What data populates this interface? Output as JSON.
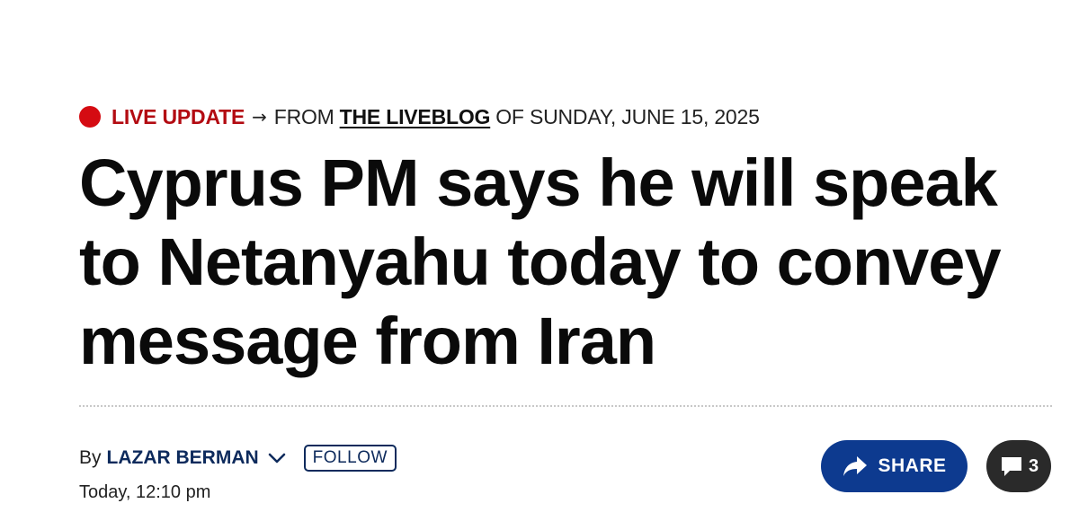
{
  "kicker": {
    "live_label": "LIVE UPDATE",
    "arrow": "→",
    "from_text": "FROM",
    "liveblog_link": "THE LIVEBLOG",
    "of_text": "OF SUNDAY, JUNE 15, 2025"
  },
  "headline": "Cyprus PM says he will speak to Netanyahu today to convey message from Iran",
  "byline": {
    "by_text": "By",
    "author": "LAZAR BERMAN",
    "follow_label": "FOLLOW",
    "timestamp": "Today, 12:10 pm"
  },
  "actions": {
    "share_label": "SHARE",
    "comment_count": "3"
  },
  "icons": {
    "live_dot": "live-dot-icon",
    "chevron": "chevron-down-icon",
    "share": "share-arrow-icon",
    "comment": "comment-bubble-icon"
  },
  "colors": {
    "live_red": "#d50b12",
    "author_navy": "#0d2a5c",
    "share_blue": "#0d3a8f",
    "comments_dark": "#2a2a2a"
  }
}
